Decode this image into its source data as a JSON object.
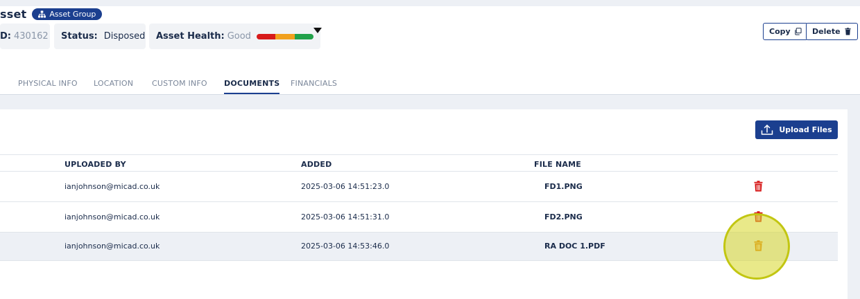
{
  "header": {
    "title": "sset",
    "group_badge": "Asset Group",
    "id_label": "D:",
    "id_value": "430162",
    "status_label": "Status:",
    "status_value": "Disposed",
    "health_label": "Asset Health:",
    "health_value": "Good",
    "copy_label": "Copy",
    "delete_label": "Delete"
  },
  "tabs": [
    {
      "label": "PHYSICAL INFO"
    },
    {
      "label": "LOCATION"
    },
    {
      "label": "CUSTOM INFO"
    },
    {
      "label": "DOCUMENTS"
    },
    {
      "label": "FINANCIALS"
    }
  ],
  "documents": {
    "upload_label": "Upload Files",
    "columns": [
      "UPLOADED BY",
      "ADDED",
      "FILE NAME"
    ],
    "rows": [
      {
        "uploaded_by": "ianjohnson@micad.co.uk",
        "added": "2025-03-06 14:51:23.0",
        "file_name": "FD1.PNG"
      },
      {
        "uploaded_by": "ianjohnson@micad.co.uk",
        "added": "2025-03-06 14:51:31.0",
        "file_name": "FD2.PNG"
      },
      {
        "uploaded_by": "ianjohnson@micad.co.uk",
        "added": "2025-03-06 14:53:46.0",
        "file_name": "RA DOC 1.PDF"
      }
    ]
  },
  "colors": {
    "brand": "#1b3f8f",
    "status_disposed": "#d71a1a",
    "trash_default": "#d71a1a",
    "trash_hover": "#e07a12"
  }
}
